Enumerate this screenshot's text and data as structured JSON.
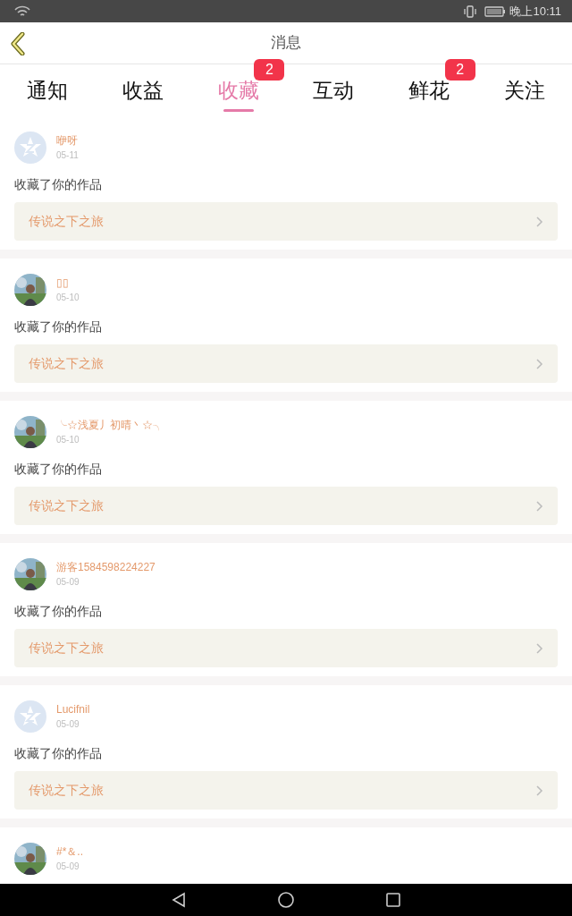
{
  "status_bar": {
    "time": "晚上10:11"
  },
  "header": {
    "title": "消息"
  },
  "tabs": [
    {
      "label": "通知",
      "selected": false
    },
    {
      "label": "收益",
      "selected": false
    },
    {
      "label": "收藏",
      "selected": true,
      "badge": "2"
    },
    {
      "label": "互动",
      "selected": false
    },
    {
      "label": "鲜花",
      "selected": false,
      "badge": "2"
    },
    {
      "label": "关注",
      "selected": false
    }
  ],
  "messages": [
    {
      "user": "咿呀",
      "avatar": {
        "kind": "default"
      },
      "date": "05-11",
      "text": "收藏了你的作品",
      "work": "传说之下之旅"
    },
    {
      "user": "▯▯",
      "date": "05-10",
      "text": "收藏了你的作品",
      "work": "传说之下之旅"
    },
    {
      "user": "╰☆浅夏丿初晴丶☆╮",
      "date": "05-10",
      "text": "收藏了你的作品",
      "work": "传说之下之旅"
    },
    {
      "user": "游客1584598224227",
      "date": "05-09",
      "text": "收藏了你的作品",
      "work": "传说之下之旅"
    },
    {
      "user": "Lucifnil",
      "avatar": {
        "kind": "default"
      },
      "date": "05-09",
      "text": "收藏了你的作品",
      "work": "传说之下之旅"
    },
    {
      "user": "#*＆..",
      "date": "05-09"
    }
  ]
}
